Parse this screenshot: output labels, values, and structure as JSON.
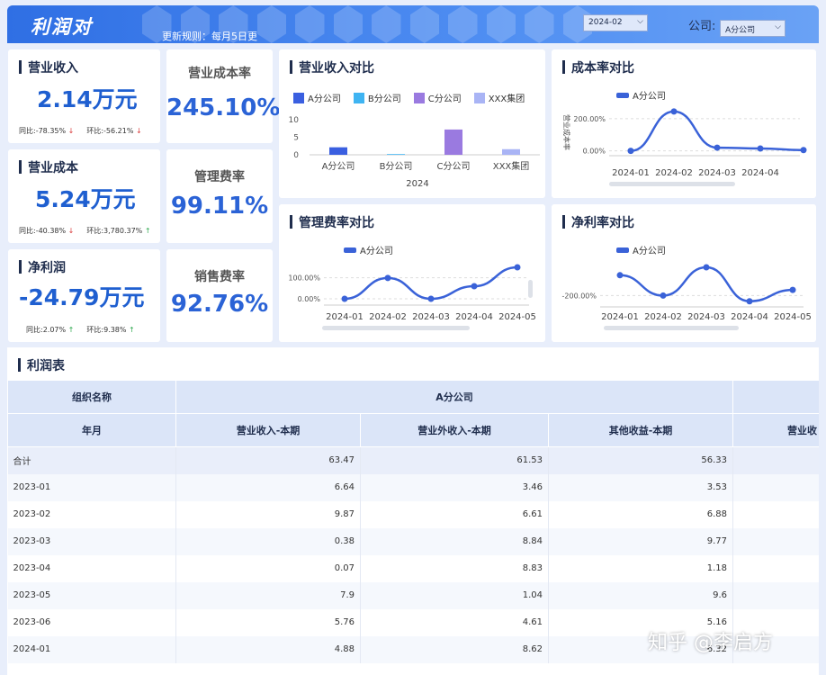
{
  "header": {
    "title": "利润对",
    "update_note": "更新规则：每月5日更",
    "date_value": "2024-02",
    "company_label": "公司:",
    "company_value": "A分公司"
  },
  "kpis": [
    {
      "label": "营业收入",
      "value": "2.14万元",
      "yoy_label": "同比:",
      "yoy": "-78.35%",
      "yoy_dir": "down",
      "mom_label": "环比:",
      "mom": "-56.21%",
      "mom_dir": "down"
    },
    {
      "label": "营业成本",
      "value": "5.24万元",
      "yoy_label": "同比:",
      "yoy": "-40.38%",
      "yoy_dir": "down",
      "mom_label": "环比:",
      "mom": "3,780.37%",
      "mom_dir": "up"
    },
    {
      "label": "净利润",
      "value": "-24.79万元",
      "yoy_label": "同比:",
      "yoy": "2.07%",
      "yoy_dir": "up",
      "mom_label": "环比:",
      "mom": "9.38%",
      "mom_dir": "up"
    }
  ],
  "rates": [
    {
      "label": "营业成本率",
      "value": "245.10%"
    },
    {
      "label": "管理费率",
      "value": "99.11%"
    },
    {
      "label": "销售费率",
      "value": "92.76%"
    }
  ],
  "chart_data": [
    {
      "type": "bar",
      "title": "营业收入对比",
      "categories": [
        "A分公司",
        "B分公司",
        "C分公司",
        "XXX集团"
      ],
      "xlabel": "2024",
      "series": [
        {
          "name": "A分公司",
          "values": [
            2.14,
            null,
            null,
            null
          ],
          "color": "#3a5fe0"
        },
        {
          "name": "B分公司",
          "values": [
            null,
            0.2,
            null,
            null
          ],
          "color": "#3fb4f2"
        },
        {
          "name": "C分公司",
          "values": [
            null,
            null,
            7.2,
            null
          ],
          "color": "#9a7ae0"
        },
        {
          "name": "XXX集团",
          "values": [
            null,
            null,
            null,
            1.6
          ],
          "color": "#a9b4f5"
        }
      ],
      "yticks": [
        "10",
        "5",
        "0"
      ],
      "ylim": [
        0,
        10
      ]
    },
    {
      "type": "line",
      "title": "成本率对比",
      "ylabel": "营业成本率",
      "x": [
        "2024-01",
        "2024-02",
        "2024-03",
        "2024-04"
      ],
      "series": [
        {
          "name": "A分公司",
          "values": [
            0,
            245.1,
            20,
            15,
            5
          ],
          "color": "#3a62d8"
        }
      ],
      "yticks": [
        "200.00%",
        "0.00%"
      ],
      "ylim": [
        -30,
        250
      ]
    },
    {
      "type": "line",
      "title": "管理费率对比",
      "x": [
        "2024-01",
        "2024-02",
        "2024-03",
        "2024-04",
        "2024-05"
      ],
      "series": [
        {
          "name": "A分公司",
          "values": [
            0,
            99.11,
            0,
            60,
            150
          ],
          "color": "#3a62d8"
        }
      ],
      "yticks": [
        "100.00%",
        "0.00%"
      ],
      "ylim": [
        -30,
        150
      ]
    },
    {
      "type": "line",
      "title": "净利率对比",
      "x": [
        "2024-01",
        "2024-02",
        "2024-03",
        "2024-04",
        "2024-05"
      ],
      "series": [
        {
          "name": "A分公司",
          "values": [
            -20,
            -200,
            50,
            -250,
            -150
          ],
          "color": "#3a62d8"
        }
      ],
      "yticks": [
        "-200.00%"
      ],
      "ylim": [
        -300,
        50
      ]
    }
  ],
  "table": {
    "title": "利润表",
    "group_header": "组织名称",
    "company_header": "A分公司",
    "columns": [
      "年月",
      "营业收入-本期",
      "营业外收入-本期",
      "其他收益-本期",
      "营业收"
    ],
    "rows": [
      [
        "合计",
        "63.47",
        "61.53",
        "56.33"
      ],
      [
        "2023-01",
        "6.64",
        "3.46",
        "3.53"
      ],
      [
        "2023-02",
        "9.87",
        "6.61",
        "6.88"
      ],
      [
        "2023-03",
        "0.38",
        "8.84",
        "9.77"
      ],
      [
        "2023-04",
        "0.07",
        "8.83",
        "1.18"
      ],
      [
        "2023-05",
        "7.9",
        "1.04",
        "9.6"
      ],
      [
        "2023-06",
        "5.76",
        "4.61",
        "5.16"
      ],
      [
        "2024-01",
        "4.88",
        "8.62",
        "6.32"
      ]
    ]
  },
  "watermark": "知乎 @李启方"
}
